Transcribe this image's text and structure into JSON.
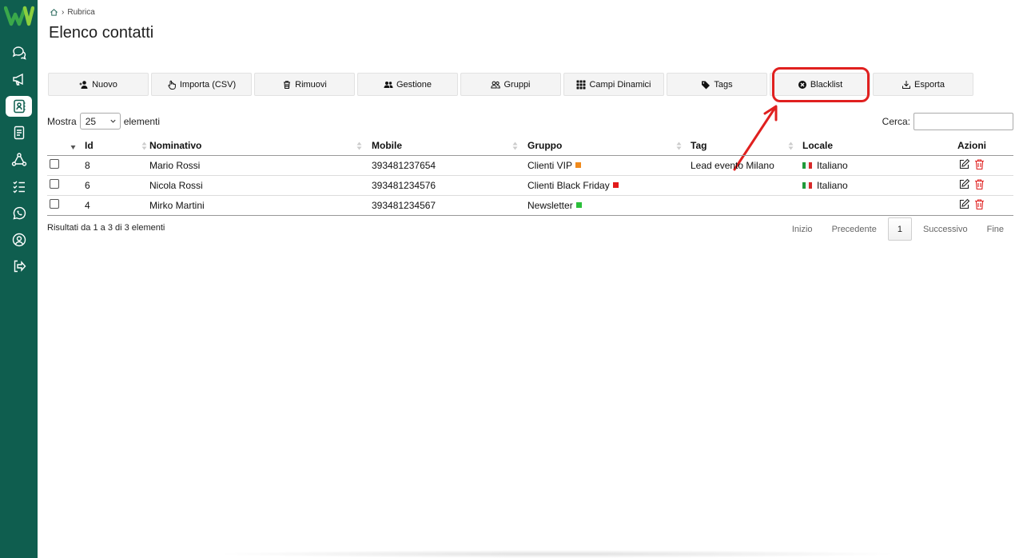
{
  "sidebar": {
    "items": [
      {
        "name": "chat-icon",
        "active": false
      },
      {
        "name": "megaphone-icon",
        "active": false
      },
      {
        "name": "contacts-icon",
        "active": true
      },
      {
        "name": "document-icon",
        "active": false
      },
      {
        "name": "workflow-icon",
        "active": false
      },
      {
        "name": "checklist-icon",
        "active": false
      },
      {
        "name": "whatsapp-icon",
        "active": false
      },
      {
        "name": "user-circle-icon",
        "active": false
      },
      {
        "name": "logout-icon",
        "active": false
      }
    ],
    "background": "#0f5e4f"
  },
  "breadcrumb": {
    "home_icon": "home-icon",
    "separator": "›",
    "current": "Rubrica"
  },
  "page_title": "Elenco contatti",
  "toolbar": {
    "buttons": [
      {
        "label": "Nuovo",
        "icon": "user-plus-icon"
      },
      {
        "label": "Importa (CSV)",
        "icon": "hand-pointer-icon"
      },
      {
        "label": "Rimuovi",
        "icon": "trash-icon"
      },
      {
        "label": "Gestione",
        "icon": "users-icon"
      },
      {
        "label": "Gruppi",
        "icon": "users-outline-icon"
      },
      {
        "label": "Campi Dinamici",
        "icon": "grid-icon"
      },
      {
        "label": "Tags",
        "icon": "tag-icon"
      },
      {
        "label": "Blacklist",
        "icon": "x-circle-icon"
      },
      {
        "label": "Esporta",
        "icon": "download-icon"
      }
    ]
  },
  "length_menu": {
    "prefix": "Mostra",
    "value": "25",
    "suffix": "elementi"
  },
  "search": {
    "label": "Cerca:",
    "value": ""
  },
  "table": {
    "columns": [
      "",
      "Id",
      "Nominativo",
      "Mobile",
      "Gruppo",
      "Tag",
      "Locale",
      "Azioni"
    ],
    "rows": [
      {
        "id": "8",
        "name": "Mario Rossi",
        "mobile": "393481237654",
        "group": "Clienti VIP",
        "group_color": "#f08a1c",
        "tag": "Lead evento Milano",
        "locale": "Italiano"
      },
      {
        "id": "6",
        "name": "Nicola Rossi",
        "mobile": "393481234576",
        "group": "Clienti Black Friday",
        "group_color": "#e21a1a",
        "tag": "",
        "locale": "Italiano"
      },
      {
        "id": "4",
        "name": "Mirko Martini",
        "mobile": "393481234567",
        "group": "Newsletter",
        "group_color": "#2bbf3a",
        "tag": "",
        "locale": ""
      }
    ]
  },
  "info": "Risultati da 1 a 3 di 3 elementi",
  "pagination": {
    "first": "Inizio",
    "prev": "Precedente",
    "current": "1",
    "next": "Successivo",
    "last": "Fine"
  },
  "annotation": {
    "color": "#e0201f"
  }
}
